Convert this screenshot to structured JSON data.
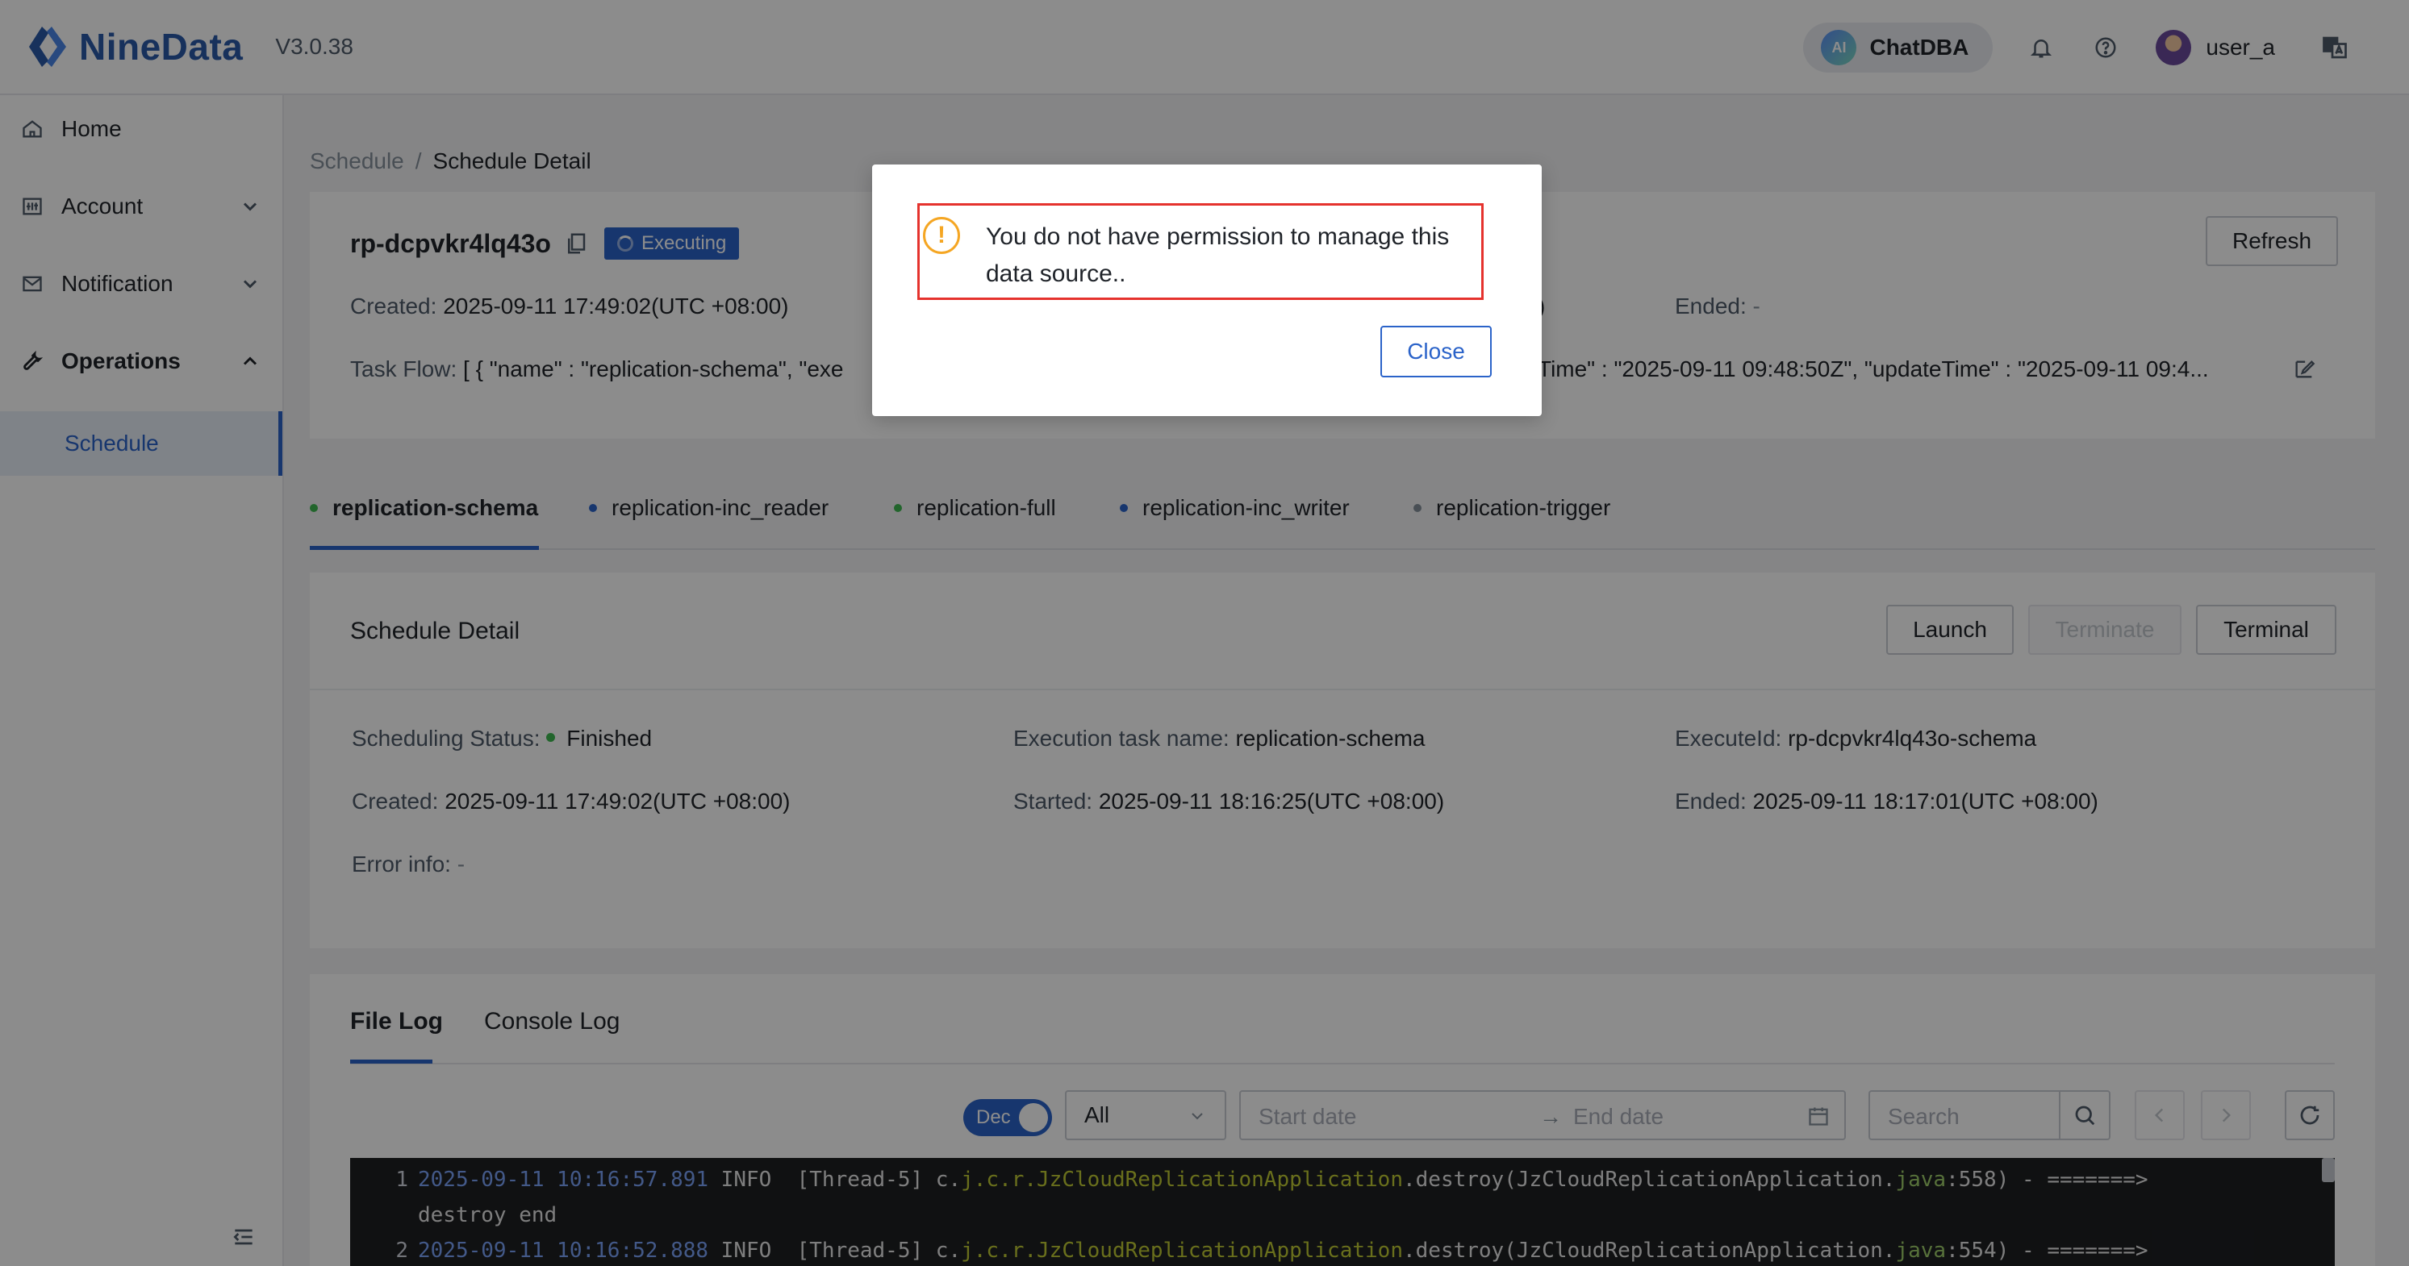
{
  "header": {
    "logo_text": "NineData",
    "version": "V3.0.38",
    "chatdba_label": "ChatDBA",
    "ai_badge": "AI",
    "username": "user_a"
  },
  "sidebar": {
    "items": [
      {
        "label": "Home"
      },
      {
        "label": "Account"
      },
      {
        "label": "Notification"
      },
      {
        "label": "Operations"
      }
    ],
    "sub_item": "Schedule"
  },
  "breadcrumb": {
    "parent": "Schedule",
    "separator": "/",
    "current": "Schedule Detail"
  },
  "task": {
    "id": "rp-dcpvkr4lq43o",
    "status": "Executing",
    "refresh_label": "Refresh",
    "created_label": "Created:",
    "created_value": "2025-09-11 17:49:02(UTC +08:00)",
    "ended_label": "Ended:",
    "ended_value": "-",
    "started_fragment": ")",
    "task_flow_label": "Task Flow:",
    "task_flow_value_left": "[ { \"name\" : \"replication-schema\", \"exe",
    "task_flow_value_right": "Time\" : \"2025-09-11 09:48:50Z\", \"updateTime\" : \"2025-09-11 09:4..."
  },
  "tabs": [
    {
      "label": "replication-schema",
      "dot_color": "#3fb950"
    },
    {
      "label": "replication-inc_reader",
      "dot_color": "#2b63c9"
    },
    {
      "label": "replication-full",
      "dot_color": "#3fb950"
    },
    {
      "label": "replication-inc_writer",
      "dot_color": "#2b63c9"
    },
    {
      "label": "replication-trigger",
      "dot_color": "#86909c"
    }
  ],
  "schedule_detail": {
    "title": "Schedule Detail",
    "launch_label": "Launch",
    "terminate_label": "Terminate",
    "terminal_label": "Terminal",
    "status_label": "Scheduling Status:",
    "status_value": "Finished",
    "exec_name_label": "Execution task name:",
    "exec_name_value": "replication-schema",
    "execute_id_label": "ExecuteId:",
    "execute_id_value": "rp-dcpvkr4lq43o-schema",
    "created_label": "Created:",
    "created_value": "2025-09-11 17:49:02(UTC +08:00)",
    "started_label": "Started:",
    "started_value": "2025-09-11 18:16:25(UTC +08:00)",
    "ended_label": "Ended:",
    "ended_value": "2025-09-11 18:17:01(UTC +08:00)",
    "error_label": "Error info:",
    "error_value": "-"
  },
  "log": {
    "tabs": [
      "File Log",
      "Console Log"
    ],
    "order_toggle": "Dec",
    "level_select": "All",
    "start_placeholder": "Start date",
    "range_arrow": "→",
    "end_placeholder": "End date",
    "search_placeholder": "Search",
    "lines": [
      {
        "num": "1",
        "date": "2025-09-11 10:16:57.891",
        "level_thread": " INFO  [Thread-5] c.",
        "cls": "j.c.r.JzCloudReplicationApplication",
        "method": ".destroy(JzCloudReplicationApplication.",
        "kw": "java",
        "tail": ":558) - =======>"
      },
      {
        "num": "",
        "text": "destroy end"
      },
      {
        "num": "2",
        "date": "2025-09-11 10:16:52.888",
        "level_thread": " INFO  [Thread-5] c.",
        "cls": "j.c.r.JzCloudReplicationApplication",
        "method": ".destroy(JzCloudReplicationApplication.",
        "kw": "java",
        "tail": ":554) - =======>"
      }
    ]
  },
  "modal": {
    "message": "You do not have permission to manage this data source..",
    "warn_glyph": "!",
    "close_label": "Close"
  }
}
